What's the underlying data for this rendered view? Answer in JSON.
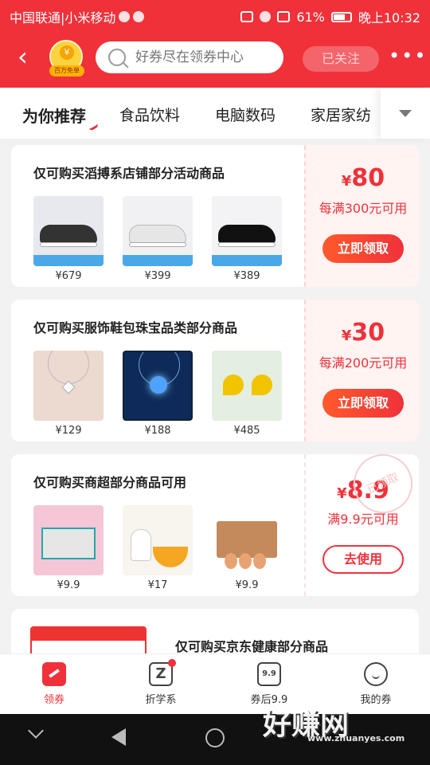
{
  "status_bar": {
    "carrier": "中国联通|小米移动",
    "battery": "61%",
    "time": "晚上10:32"
  },
  "header": {
    "mascot_badge": "百万免单",
    "search_placeholder": "好券尽在领券中心",
    "follow_label": "已关注"
  },
  "tabs": [
    "为你推荐",
    "食品饮料",
    "电脑数码",
    "家居家纺"
  ],
  "coupons": [
    {
      "title": "仅可购买滔搏系店铺部分活动商品",
      "products": [
        {
          "price": "¥679"
        },
        {
          "price": "¥399"
        },
        {
          "price": "¥389"
        }
      ],
      "currency": "¥",
      "amount": "80",
      "condition": "每满300元可用",
      "action": "立即领取"
    },
    {
      "title": "仅可购买服饰鞋包珠宝品类部分商品",
      "products": [
        {
          "price": "¥129"
        },
        {
          "price": "¥188"
        },
        {
          "price": "¥485"
        }
      ],
      "currency": "¥",
      "amount": "30",
      "condition": "每满200元可用",
      "action": "立即领取"
    },
    {
      "title": "仅可购买商超部分商品可用",
      "products": [
        {
          "price": "¥9.9"
        },
        {
          "price": "¥17"
        },
        {
          "price": "¥9.9"
        }
      ],
      "currency": "¥",
      "amount": "8.9",
      "condition": "满9.9元可用",
      "action": "去使用",
      "stamp": "已领取"
    },
    {
      "title": "仅可购买京东健康部分商品"
    }
  ],
  "bottom_nav": [
    {
      "label": "领券",
      "icon": "coupon-icon"
    },
    {
      "label": "折学系",
      "icon": "z-icon"
    },
    {
      "label": "券后9.9",
      "icon": "nine-nine-icon",
      "icon_text": "9.9"
    },
    {
      "label": "我的券",
      "icon": "smile-icon"
    }
  ],
  "watermark": {
    "text": "好赚网",
    "url": "www.zhuanyes.com"
  },
  "colors": {
    "brand_red": "#f0313a",
    "coupon_bg": "#fff4f2"
  }
}
